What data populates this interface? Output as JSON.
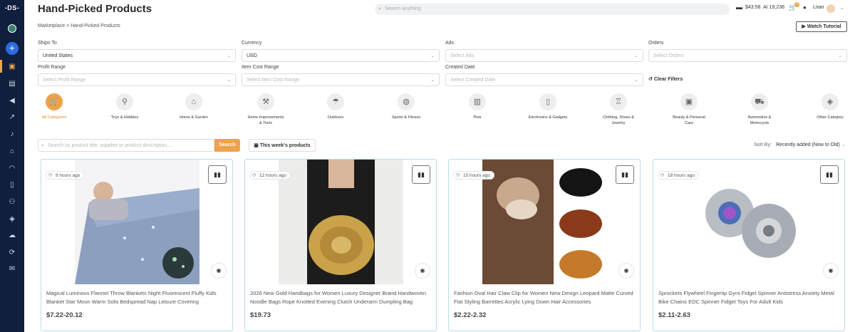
{
  "sidebar": {
    "logo": "-DS-",
    "items": [
      "store-icon",
      "cart-icon",
      "megaphone-icon",
      "chart-icon",
      "tiktok-icon",
      "shop-icon",
      "gauge-icon",
      "document-icon",
      "users-icon",
      "box-icon",
      "cloud-icon",
      "sync-icon",
      "mail-icon"
    ]
  },
  "header": {
    "title": "Hand-Picked Products",
    "search_placeholder": "Search anything",
    "balance": "$43.58",
    "ai_credits": "AI 19,236",
    "cart_badge": "3",
    "user_name": "Liran"
  },
  "breadcrumb": "Marketplace > Hand-Picked Products",
  "watch_tutorial": "Watch Tutorial",
  "filters": {
    "ships_to": {
      "label": "Ships To",
      "value": "United States"
    },
    "currency": {
      "label": "Currency",
      "value": "USD"
    },
    "ads": {
      "label": "Ads",
      "placeholder": "Select Ads"
    },
    "orders": {
      "label": "Orders",
      "placeholder": "Select Orders"
    },
    "profit_range": {
      "label": "Profit Range",
      "placeholder": "Select Profit Range"
    },
    "item_cost_range": {
      "label": "Item Cost Range",
      "placeholder": "Select Item Cost Range"
    },
    "created_date": {
      "label": "Created Date",
      "placeholder": "Select Created Date"
    },
    "clear": "Clear Filters"
  },
  "categories": [
    {
      "label": "All Categories",
      "icon": "cart-icon"
    },
    {
      "label": "Toys & Hobbies",
      "icon": "bicycle-icon"
    },
    {
      "label": "Home & Garden",
      "icon": "house-icon"
    },
    {
      "label": "Home Improvements & Tools",
      "icon": "tools-icon"
    },
    {
      "label": "Outdoors",
      "icon": "umbrella-icon"
    },
    {
      "label": "Sports & Fitness",
      "icon": "ball-icon"
    },
    {
      "label": "Pets",
      "icon": "pet-icon"
    },
    {
      "label": "Electronics & Gadgets",
      "icon": "phone-icon"
    },
    {
      "label": "Clothing, Shoes & Jewelry",
      "icon": "hanger-icon"
    },
    {
      "label": "Beauty & Personal Care",
      "icon": "beauty-icon"
    },
    {
      "label": "Automotive & Motorcycle",
      "icon": "car-icon"
    },
    {
      "label": "Other Category",
      "icon": "box-icon"
    }
  ],
  "product_search": {
    "placeholder": "Search by product title, supplier or product description...",
    "button": "Search"
  },
  "week_button": "This week's products",
  "sort": {
    "label": "Sort By:",
    "value": "Recently added (New to Old)"
  },
  "products": [
    {
      "time": "9 hours ago",
      "title": "Magical Luminous Flannel Throw Blankets Night Fluorescent Fluffy Kids Blanket Star Moon Warm Sofa Bedspread Nap Leisure Covering",
      "price": "$7.22-20.12"
    },
    {
      "time": "12 hours ago",
      "title": "2026 New Gold Handbags for Women Luxury Designer Brand Handwoven Noodle Bags Rope Knotted Evening Clutch Underarm Dumpling Bag",
      "price": "$19.73"
    },
    {
      "time": "15 hours ago",
      "title": "Fashion Oval Hair Claw Clip for Women New Design Leopard Matte Curved Flat Styling Barrettes Acrylic Lying Down Hair Accessories",
      "price": "$2.22-2.32"
    },
    {
      "time": "18 hours ago",
      "title": "Sprockets Flywheel Fingertip Gyro Fidget Spinner Antistress Anxiety Metal Bike Chains EDC Spinner Fidget Toys For Adult Kids",
      "price": "$2.11-2.63"
    }
  ]
}
